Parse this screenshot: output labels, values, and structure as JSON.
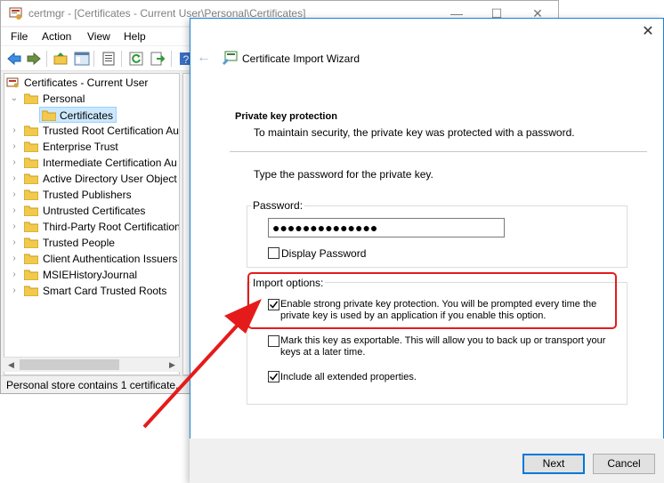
{
  "window": {
    "title": "certmgr - [Certificates - Current User\\Personal\\Certificates]",
    "minimize": "—",
    "maximize": "☐",
    "close": "✕"
  },
  "menu": [
    "File",
    "Action",
    "View",
    "Help"
  ],
  "tree": {
    "root": "Certificates - Current User",
    "personal": "Personal",
    "selected": "Certificates",
    "stores": [
      "Trusted Root Certification Au",
      "Enterprise Trust",
      "Intermediate Certification Au",
      "Active Directory User Object",
      "Trusted Publishers",
      "Untrusted Certificates",
      "Third-Party Root Certification",
      "Trusted People",
      "Client Authentication Issuers",
      "MSIEHistoryJournal",
      "Smart Card Trusted Roots"
    ]
  },
  "status": "Personal store contains 1 certificate.",
  "dialog": {
    "title": "Certificate Import Wizard",
    "close": "✕",
    "back": "←",
    "heading": "Private key protection",
    "subheading": "To maintain security, the private key was protected with a password.",
    "prompt": "Type the password for the private key.",
    "password_label": "Password:",
    "password_value": "●●●●●●●●●●●●●●",
    "display_password": "Display Password",
    "import_options_label": "Import options:",
    "options": [
      {
        "label": "Enable strong private key protection. You will be prompted every time the private key is used by an application if you enable this option.",
        "checked": true
      },
      {
        "label": "Mark this key as exportable. This will allow you to back up or transport your keys at a later time.",
        "checked": false
      },
      {
        "label": "Include all extended properties.",
        "checked": true
      }
    ],
    "next": "Next",
    "cancel": "Cancel"
  },
  "colors": {
    "accent": "#0078d7",
    "highlight": "#e51b1b",
    "selection": "#cce8ff",
    "folder": "#f2c94c"
  }
}
